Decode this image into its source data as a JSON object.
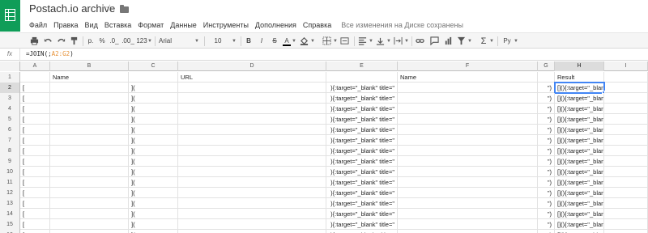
{
  "window": {
    "title": "Postach.io archive",
    "save_status": "Все изменения на Диске сохранены"
  },
  "menu": [
    "Файл",
    "Правка",
    "Вид",
    "Вставка",
    "Формат",
    "Данные",
    "Инструменты",
    "Дополнения",
    "Справка"
  ],
  "toolbar": {
    "currency": "р.",
    "percent": "%",
    "dec_minus": ".0_",
    "dec_plus": ".00_",
    "more_formats": "123",
    "font": "Arial",
    "font_size": "10",
    "bold": "B",
    "italic": "I",
    "strike": "S",
    "text_color": "A",
    "input_tools": "Ру"
  },
  "formula_bar": {
    "fx": "fx",
    "formula_prefix": "=JOIN(;",
    "formula_ref": "A2:G2",
    "formula_suffix": ")"
  },
  "columns": [
    "A",
    "B",
    "C",
    "D",
    "E",
    "F",
    "G",
    "H",
    "I"
  ],
  "header_row": {
    "number": "1",
    "B": "Name",
    "D": "URL",
    "F": "Name",
    "H": "Result"
  },
  "rows": [
    {
      "n": "2",
      "A": "[",
      "C": "](",
      "E": "){:target=\"_blank\" title=\"",
      "G": "\")",
      "H": "[](){:target=\"_blank\" title=\"\"}"
    },
    {
      "n": "3",
      "A": "[",
      "C": "](",
      "E": "){:target=\"_blank\" title=\"",
      "G": "\")",
      "H": "[](){:target=\"_blank\" title=\"\"}"
    },
    {
      "n": "4",
      "A": "[",
      "C": "](",
      "E": "){:target=\"_blank\" title=\"",
      "G": "\")",
      "H": "[](){:target=\"_blank\" title=\"\"}"
    },
    {
      "n": "5",
      "A": "[",
      "C": "](",
      "E": "){:target=\"_blank\" title=\"",
      "G": "\")",
      "H": "[](){:target=\"_blank\" title=\"\"}"
    },
    {
      "n": "6",
      "A": "[",
      "C": "](",
      "E": "){:target=\"_blank\" title=\"",
      "G": "\")",
      "H": "[](){:target=\"_blank\" title=\"\"}"
    },
    {
      "n": "7",
      "A": "[",
      "C": "](",
      "E": "){:target=\"_blank\" title=\"",
      "G": "\")",
      "H": "[](){:target=\"_blank\" title=\"\"}"
    },
    {
      "n": "8",
      "A": "[",
      "C": "](",
      "E": "){:target=\"_blank\" title=\"",
      "G": "\")",
      "H": "[](){:target=\"_blank\" title=\"\"}"
    },
    {
      "n": "9",
      "A": "[",
      "C": "](",
      "E": "){:target=\"_blank\" title=\"",
      "G": "\")",
      "H": "[](){:target=\"_blank\" title=\"\"}"
    },
    {
      "n": "10",
      "A": "[",
      "C": "](",
      "E": "){:target=\"_blank\" title=\"",
      "G": "\")",
      "H": "[](){:target=\"_blank\" title=\"\"}"
    },
    {
      "n": "11",
      "A": "[",
      "C": "](",
      "E": "){:target=\"_blank\" title=\"",
      "G": "\")",
      "H": "[](){:target=\"_blank\" title=\"\"}"
    },
    {
      "n": "12",
      "A": "[",
      "C": "](",
      "E": "){:target=\"_blank\" title=\"",
      "G": "\")",
      "H": "[](){:target=\"_blank\" title=\"\"}"
    },
    {
      "n": "13",
      "A": "[",
      "C": "](",
      "E": "){:target=\"_blank\" title=\"",
      "G": "\")",
      "H": "[](){:target=\"_blank\" title=\"\"}"
    },
    {
      "n": "14",
      "A": "[",
      "C": "](",
      "E": "){:target=\"_blank\" title=\"",
      "G": "\")",
      "H": "[](){:target=\"_blank\" title=\"\"}"
    },
    {
      "n": "15",
      "A": "[",
      "C": "](",
      "E": "){:target=\"_blank\" title=\"",
      "G": "\")",
      "H": "[](){:target=\"_blank\" title=\"\"}"
    },
    {
      "n": "16",
      "A": "[",
      "C": "](",
      "E": "){:target=\"_blank\" title=\"",
      "G": "\")",
      "H": "[](){:target=\"_blank\" title=\"\"}"
    }
  ],
  "selection": {
    "active_row": "2",
    "active_col": "H"
  },
  "colors": {
    "brand": "#0f9d58",
    "selection": "#4285f4",
    "formula_ref": "#e69138"
  }
}
